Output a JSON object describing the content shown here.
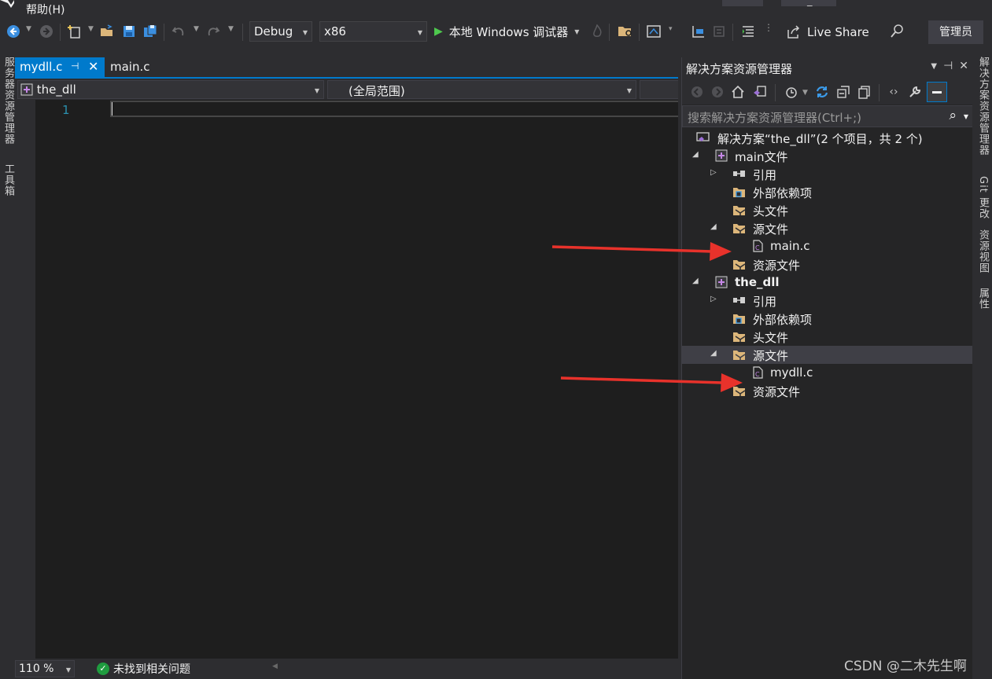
{
  "menu": {
    "help_label": "帮助(H)"
  },
  "toolbar": {
    "config": "Debug",
    "platform": "x86",
    "run_label": "本地 Windows 调试器",
    "live_share_label": "Live Share",
    "admin_badge": "管理员"
  },
  "left_strip": {
    "server_explorer": "服务器资源管理器",
    "toolbox": "工具箱"
  },
  "editor": {
    "tabs": [
      {
        "label": "mydll.c",
        "active": true
      },
      {
        "label": "main.c",
        "active": false
      }
    ],
    "nav_project": "the_dll",
    "nav_scope": "(全局范围)",
    "line_number": "1",
    "zoom": "110 %",
    "issues_label": "未找到相关问题"
  },
  "solution_explorer": {
    "title": "解决方案资源管理器",
    "search_placeholder": "搜索解决方案资源管理器(Ctrl+;)",
    "tree": [
      {
        "label": "解决方案“the_dll”(2 个项目，共 2 个)",
        "icon": "solution-icon",
        "level": 0
      },
      {
        "label": "main文件",
        "icon": "project-icon",
        "level": 1,
        "expanded": true
      },
      {
        "label": "引用",
        "icon": "references-icon",
        "level": 2,
        "expanded": false
      },
      {
        "label": "外部依赖项",
        "icon": "external-deps-icon",
        "level": 2
      },
      {
        "label": "头文件",
        "icon": "filter-folder-icon",
        "level": 2
      },
      {
        "label": "源文件",
        "icon": "filter-folder-icon",
        "level": 2,
        "expanded": true
      },
      {
        "label": "main.c",
        "icon": "c-file-icon",
        "level": 3
      },
      {
        "label": "资源文件",
        "icon": "filter-folder-icon",
        "level": 2
      },
      {
        "label": "the_dll",
        "icon": "project-icon",
        "level": 1,
        "expanded": true,
        "bold": true
      },
      {
        "label": "引用",
        "icon": "references-icon",
        "level": 2,
        "expanded": false
      },
      {
        "label": "外部依赖项",
        "icon": "external-deps-icon",
        "level": 2
      },
      {
        "label": "头文件",
        "icon": "filter-folder-icon",
        "level": 2
      },
      {
        "label": "源文件",
        "icon": "filter-folder-icon",
        "level": 2,
        "expanded": true,
        "selected": true
      },
      {
        "label": "mydll.c",
        "icon": "c-file-icon",
        "level": 3
      },
      {
        "label": "资源文件",
        "icon": "filter-folder-icon",
        "level": 2
      }
    ]
  },
  "right_strip": {
    "solution_explorer": "解决方案资源管理器",
    "git_changes": "Git 更改",
    "class_view": "资源视图",
    "properties": "属性"
  },
  "watermark": "CSDN @二木先生啊",
  "colors": {
    "accent": "#007acc",
    "background": "#2d2d30",
    "editor_bg": "#1e1e1e",
    "arrow": "#e8322b",
    "run_green": "#4ec94e"
  }
}
